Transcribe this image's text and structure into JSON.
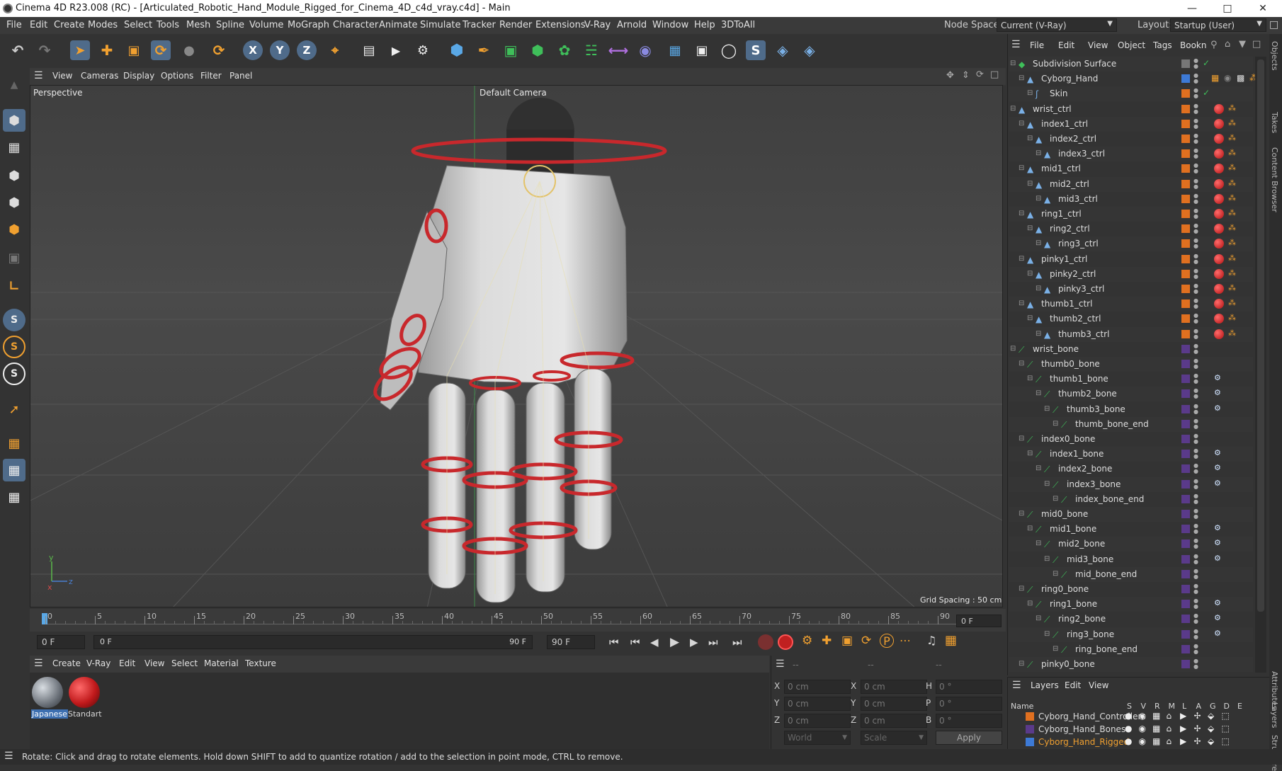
{
  "window": {
    "title": "Cinema 4D R23.008 (RC) - [Articulated_Robotic_Hand_Module_Rigged_for_Cinema_4D_c4d_vray.c4d] - Main"
  },
  "menubar": {
    "items": [
      "File",
      "Edit",
      "Create",
      "Modes",
      "Select",
      "Tools",
      "Mesh",
      "Spline",
      "Volume",
      "MoGraph",
      "Character",
      "Animate",
      "Simulate",
      "Tracker",
      "Render",
      "Extensions",
      "V-Ray",
      "Arnold",
      "Window",
      "Help",
      "3DToAll"
    ],
    "node_space_label": "Node Space:",
    "node_space_value": "Current (V-Ray)",
    "layout_label": "Layout:",
    "layout_value": "Startup (User)"
  },
  "viewport": {
    "menu": [
      "View",
      "Cameras",
      "Display",
      "Options",
      "Filter",
      "Panel"
    ],
    "view_name": "Perspective",
    "camera": "Default Camera",
    "grid_spacing": "Grid Spacing : 50 cm"
  },
  "timeline": {
    "ticks": [
      "0",
      "5",
      "10",
      "15",
      "20",
      "25",
      "30",
      "35",
      "40",
      "45",
      "50",
      "55",
      "60",
      "65",
      "70",
      "75",
      "80",
      "85",
      "90"
    ],
    "current_frame_field": "0 F",
    "start_field": "0 F",
    "range_start": "0 F",
    "range_end": "90 F",
    "end_field": "90 F"
  },
  "material_manager": {
    "menu": [
      "Create",
      "V-Ray",
      "Edit",
      "View",
      "Select",
      "Material",
      "Texture"
    ],
    "materials": [
      {
        "name": "Japanese",
        "color": "#8a8f95"
      },
      {
        "name": "Standart",
        "color": "#c0191b"
      }
    ]
  },
  "coordinates": {
    "col1": [
      {
        "axis": "X",
        "value": "0 cm"
      },
      {
        "axis": "Y",
        "value": "0 cm"
      },
      {
        "axis": "Z",
        "value": "0 cm"
      }
    ],
    "col2": [
      {
        "axis": "X",
        "value": "0 cm"
      },
      {
        "axis": "Y",
        "value": "0 cm"
      },
      {
        "axis": "Z",
        "value": "0 cm"
      }
    ],
    "col3": [
      {
        "axis": "H",
        "value": "0 °"
      },
      {
        "axis": "P",
        "value": "0 °"
      },
      {
        "axis": "B",
        "value": "0 °"
      }
    ],
    "header_left": "--",
    "header_mid": "--",
    "header_right": "--",
    "mode_world": "World",
    "mode_scale": "Scale",
    "apply": "Apply"
  },
  "object_manager": {
    "menu": [
      "File",
      "Edit",
      "View",
      "Object",
      "Tags",
      "Bookn"
    ],
    "objects": [
      {
        "name": "Subdivision Surface",
        "depth": 0,
        "type": "subdiv",
        "color": "#777777"
      },
      {
        "name": "Cyborg_Hand",
        "depth": 1,
        "type": "poly",
        "color": "#3d7ad6"
      },
      {
        "name": "Skin",
        "depth": 2,
        "type": "skin",
        "color": "#e07020"
      },
      {
        "name": "wrist_ctrl",
        "depth": 0,
        "type": "ctrl",
        "color": "#e07020"
      },
      {
        "name": "index1_ctrl",
        "depth": 1,
        "type": "ctrl",
        "color": "#e07020"
      },
      {
        "name": "index2_ctrl",
        "depth": 2,
        "type": "ctrl",
        "color": "#e07020"
      },
      {
        "name": "index3_ctrl",
        "depth": 3,
        "type": "ctrl",
        "color": "#e07020"
      },
      {
        "name": "mid1_ctrl",
        "depth": 1,
        "type": "ctrl",
        "color": "#e07020"
      },
      {
        "name": "mid2_ctrl",
        "depth": 2,
        "type": "ctrl",
        "color": "#e07020"
      },
      {
        "name": "mid3_ctrl",
        "depth": 3,
        "type": "ctrl",
        "color": "#e07020"
      },
      {
        "name": "ring1_ctrl",
        "depth": 1,
        "type": "ctrl",
        "color": "#e07020"
      },
      {
        "name": "ring2_ctrl",
        "depth": 2,
        "type": "ctrl",
        "color": "#e07020"
      },
      {
        "name": "ring3_ctrl",
        "depth": 3,
        "type": "ctrl",
        "color": "#e07020"
      },
      {
        "name": "pinky1_ctrl",
        "depth": 1,
        "type": "ctrl",
        "color": "#e07020"
      },
      {
        "name": "pinky2_ctrl",
        "depth": 2,
        "type": "ctrl",
        "color": "#e07020"
      },
      {
        "name": "pinky3_ctrl",
        "depth": 3,
        "type": "ctrl",
        "color": "#e07020"
      },
      {
        "name": "thumb1_ctrl",
        "depth": 1,
        "type": "ctrl",
        "color": "#e07020"
      },
      {
        "name": "thumb2_ctrl",
        "depth": 2,
        "type": "ctrl",
        "color": "#e07020"
      },
      {
        "name": "thumb3_ctrl",
        "depth": 3,
        "type": "ctrl",
        "color": "#e07020"
      },
      {
        "name": "wrist_bone",
        "depth": 0,
        "type": "bone",
        "color": "#5a3a8a"
      },
      {
        "name": "thumb0_bone",
        "depth": 1,
        "type": "bone",
        "color": "#5a3a8a"
      },
      {
        "name": "thumb1_bone",
        "depth": 2,
        "type": "bone",
        "color": "#5a3a8a"
      },
      {
        "name": "thumb2_bone",
        "depth": 3,
        "type": "bone",
        "color": "#5a3a8a"
      },
      {
        "name": "thumb3_bone",
        "depth": 4,
        "type": "bone",
        "color": "#5a3a8a"
      },
      {
        "name": "thumb_bone_end",
        "depth": 5,
        "type": "bone",
        "color": "#5a3a8a"
      },
      {
        "name": "index0_bone",
        "depth": 1,
        "type": "bone",
        "color": "#5a3a8a"
      },
      {
        "name": "index1_bone",
        "depth": 2,
        "type": "bone",
        "color": "#5a3a8a"
      },
      {
        "name": "index2_bone",
        "depth": 3,
        "type": "bone",
        "color": "#5a3a8a"
      },
      {
        "name": "index3_bone",
        "depth": 4,
        "type": "bone",
        "color": "#5a3a8a"
      },
      {
        "name": "index_bone_end",
        "depth": 5,
        "type": "bone",
        "color": "#5a3a8a"
      },
      {
        "name": "mid0_bone",
        "depth": 1,
        "type": "bone",
        "color": "#5a3a8a"
      },
      {
        "name": "mid1_bone",
        "depth": 2,
        "type": "bone",
        "color": "#5a3a8a"
      },
      {
        "name": "mid2_bone",
        "depth": 3,
        "type": "bone",
        "color": "#5a3a8a"
      },
      {
        "name": "mid3_bone",
        "depth": 4,
        "type": "bone",
        "color": "#5a3a8a"
      },
      {
        "name": "mid_bone_end",
        "depth": 5,
        "type": "bone",
        "color": "#5a3a8a"
      },
      {
        "name": "ring0_bone",
        "depth": 1,
        "type": "bone",
        "color": "#5a3a8a"
      },
      {
        "name": "ring1_bone",
        "depth": 2,
        "type": "bone",
        "color": "#5a3a8a"
      },
      {
        "name": "ring2_bone",
        "depth": 3,
        "type": "bone",
        "color": "#5a3a8a"
      },
      {
        "name": "ring3_bone",
        "depth": 4,
        "type": "bone",
        "color": "#5a3a8a"
      },
      {
        "name": "ring_bone_end",
        "depth": 5,
        "type": "bone",
        "color": "#5a3a8a"
      },
      {
        "name": "pinky0_bone",
        "depth": 1,
        "type": "bone",
        "color": "#5a3a8a"
      }
    ]
  },
  "layer_manager": {
    "menu": [
      "Layers",
      "Edit",
      "View"
    ],
    "header_name": "Name",
    "columns": [
      "S",
      "V",
      "R",
      "M",
      "L",
      "A",
      "G",
      "D",
      "E"
    ],
    "layers": [
      {
        "name": "Cyborg_Hand_Controllers",
        "color": "#e07020",
        "active": false
      },
      {
        "name": "Cyborg_Hand_Bones",
        "color": "#5a3a8a",
        "active": false
      },
      {
        "name": "Cyborg_Hand_Rigged",
        "color": "#3d7ad6",
        "active": true
      }
    ]
  },
  "side_tabs": [
    "Objects",
    "Takes",
    "Content Browser",
    "Attributes",
    "Layers",
    "Structure"
  ],
  "status": "Rotate: Click and drag to rotate elements. Hold down SHIFT to add to quantize rotation / add to the selection in point mode, CTRL to remove."
}
